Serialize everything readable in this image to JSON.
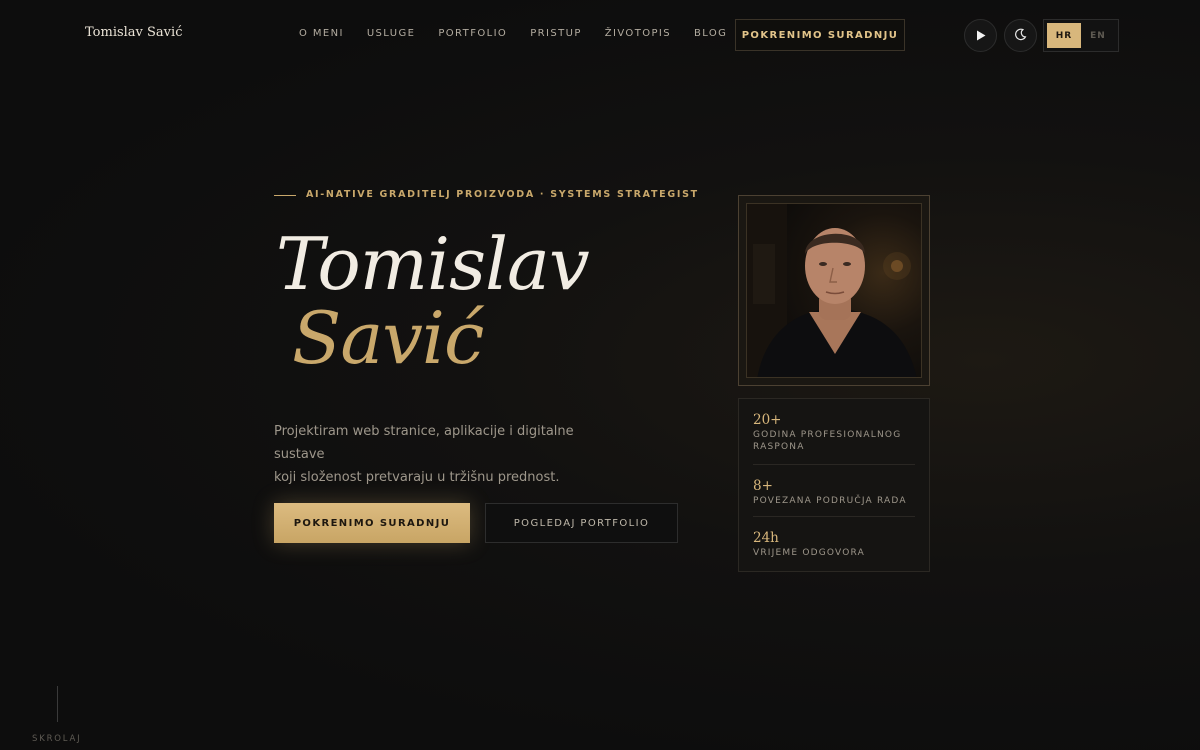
{
  "header": {
    "brand": "Tomislav Savić",
    "nav": [
      "O MENI",
      "USLUGE",
      "PORTFOLIO",
      "PRISTUP",
      "ŽIVOTOPIS",
      "BLOG"
    ],
    "cta": "POKRENIMO SURADNJU",
    "play_icon": "play-icon",
    "theme_icon": "moon-icon",
    "lang": {
      "active": "HR",
      "inactive": "EN"
    }
  },
  "hero": {
    "eyebrow": "AI-NATIVE GRADITELJ PROIZVODA · SYSTEMS STRATEGIST",
    "name_first": "Tomislav",
    "name_last": "Savić",
    "desc_line1": "Projektiram web stranice, aplikacije i digitalne sustave",
    "desc_line2": "koji složenost pretvaraju u tržišnu prednost.",
    "primary_btn": "POKRENIMO SURADNJU",
    "secondary_btn": "POGLEDAJ PORTFOLIO"
  },
  "stats": [
    {
      "value": "20+",
      "label": "GODINA PROFESIONALNOG RASPONA"
    },
    {
      "value": "8+",
      "label": "POVEZANA PODRUČJA RADA"
    },
    {
      "value": "24h",
      "label": "VRIJEME ODGOVORA"
    }
  ],
  "scroll": {
    "label": "SKROLAJ"
  },
  "colors": {
    "accent": "#c9a86b",
    "accent_button": "#d8b77c",
    "background": "#0f0f0f",
    "heading": "#f1ece3"
  }
}
